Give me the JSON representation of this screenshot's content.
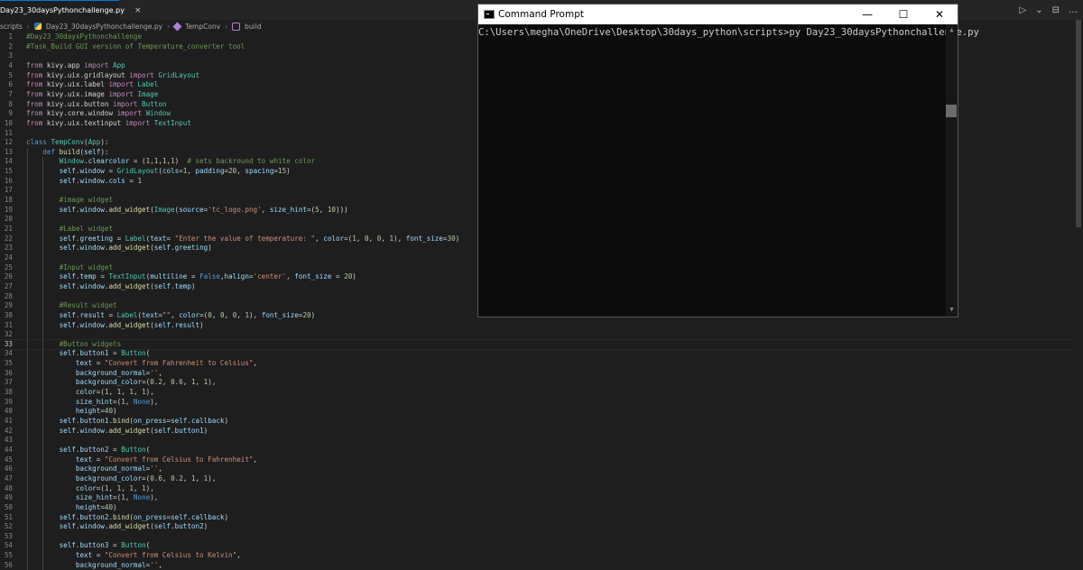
{
  "tab": {
    "title": "Day23_30daysPythonchallenge.py",
    "close": "×"
  },
  "tab_actions": {
    "run": "▷",
    "run_menu": "⌄",
    "split": "⊟",
    "more": "…"
  },
  "breadcrumb": {
    "folder": "scripts",
    "file": "Day23_30daysPythonchallenge.py",
    "class": "TempConv",
    "method": "build"
  },
  "editor": {
    "lines": [
      {
        "n": "1",
        "html": "<span class='cmt'>#Day23_30daysPythonchallenge</span>"
      },
      {
        "n": "2",
        "html": "<span class='cmt'>#Task_Build GUI version of Temperature_converter tool</span>"
      },
      {
        "n": "3",
        "html": ""
      },
      {
        "n": "4",
        "html": "<span class='kw2'>from</span> kivy.app <span class='kw2'>import</span> <span class='cls'>App</span>"
      },
      {
        "n": "5",
        "html": "<span class='kw2'>from</span> kivy.uix.gridlayout <span class='kw2'>import</span> <span class='cls'>GridLayout</span>"
      },
      {
        "n": "6",
        "html": "<span class='kw2'>from</span> kivy.uix.label <span class='kw2'>import</span> <span class='cls'>Label</span>"
      },
      {
        "n": "7",
        "html": "<span class='kw2'>from</span> kivy.uix.image <span class='kw2'>import</span> <span class='cls'>Image</span>"
      },
      {
        "n": "8",
        "html": "<span class='kw2'>from</span> kivy.uix.button <span class='kw2'>import</span> <span class='cls'>Button</span>"
      },
      {
        "n": "9",
        "html": "<span class='kw2'>from</span> kivy.core.window <span class='kw2'>import</span> <span class='cls'>Window</span>"
      },
      {
        "n": "10",
        "html": "<span class='kw2'>from</span> kivy.uix.textinput <span class='kw2'>import</span> <span class='cls'>TextInput</span>"
      },
      {
        "n": "11",
        "html": ""
      },
      {
        "n": "12",
        "html": "<span class='kw'>class</span> <span class='cls'>TempConv</span>(<span class='cls'>App</span>):"
      },
      {
        "n": "13",
        "html": "    <span class='kw'>def</span> <span class='fn'>build</span>(<span class='self'>self</span>):"
      },
      {
        "n": "14",
        "html": "        <span class='cls'>Window</span>.<span class='var'>clearcolor</span> = (<span class='num'>1</span>,<span class='num'>1</span>,<span class='num'>1</span>,<span class='num'>1</span>)  <span class='cmt'># sets backround to white color</span>"
      },
      {
        "n": "15",
        "html": "        <span class='self'>self</span>.<span class='var'>window</span> = <span class='cls'>GridLayout</span>(<span class='var'>cols</span>=<span class='num'>1</span>, <span class='var'>padding</span>=<span class='num'>20</span>, <span class='var'>spacing</span>=<span class='num'>15</span>)"
      },
      {
        "n": "16",
        "html": "        <span class='self'>self</span>.<span class='var'>window</span>.<span class='var'>cols</span> = <span class='num'>1</span>"
      },
      {
        "n": "17",
        "html": ""
      },
      {
        "n": "18",
        "html": "        <span class='cmt'>#image widget</span>"
      },
      {
        "n": "19",
        "html": "        <span class='self'>self</span>.<span class='var'>window</span>.<span class='fn'>add_widget</span>(<span class='cls'>Image</span>(<span class='var'>source</span>=<span class='str'>'tc_logo.png'</span>, <span class='var'>size_hint</span>=(<span class='num'>5</span>, <span class='num'>10</span>)))"
      },
      {
        "n": "20",
        "html": ""
      },
      {
        "n": "21",
        "html": "        <span class='cmt'>#Label widget</span>"
      },
      {
        "n": "22",
        "html": "        <span class='self'>self</span>.<span class='var'>greeting</span> = <span class='cls'>Label</span>(<span class='var'>text</span>= <span class='str'>\"Enter the value of temperature: \"</span>, <span class='var'>color</span>=(<span class='num'>1</span>, <span class='num'>0</span>, <span class='num'>0</span>, <span class='num'>1</span>), <span class='var'>font_size</span>=<span class='num'>30</span>)"
      },
      {
        "n": "23",
        "html": "        <span class='self'>self</span>.<span class='var'>window</span>.<span class='fn'>add_widget</span>(<span class='self'>self</span>.<span class='var'>greeting</span>)"
      },
      {
        "n": "24",
        "html": ""
      },
      {
        "n": "25",
        "html": "        <span class='cmt'>#Input widget</span>"
      },
      {
        "n": "26",
        "html": "        <span class='self'>self</span>.<span class='var'>temp</span> = <span class='cls'>TextInput</span>(<span class='var'>multiline</span> = <span class='kw'>False</span>,<span class='var'>halign</span>=<span class='str'>'center'</span>, <span class='var'>font_size</span> = <span class='num'>20</span>)"
      },
      {
        "n": "27",
        "html": "        <span class='self'>self</span>.<span class='var'>window</span>.<span class='fn'>add_widget</span>(<span class='self'>self</span>.<span class='var'>temp</span>)"
      },
      {
        "n": "28",
        "html": ""
      },
      {
        "n": "29",
        "html": "        <span class='cmt'>#Result widget</span>"
      },
      {
        "n": "30",
        "html": "        <span class='self'>self</span>.<span class='var'>result</span> = <span class='cls'>Label</span>(<span class='var'>text</span>=<span class='str'>\"\"</span>, <span class='var'>color</span>=(<span class='num'>0</span>, <span class='num'>0</span>, <span class='num'>0</span>, <span class='num'>1</span>), <span class='var'>font_size</span>=<span class='num'>20</span>)"
      },
      {
        "n": "31",
        "html": "        <span class='self'>self</span>.<span class='var'>window</span>.<span class='fn'>add_widget</span>(<span class='self'>self</span>.<span class='var'>result</span>)"
      },
      {
        "n": "32",
        "html": ""
      },
      {
        "n": "33",
        "html": "        <span class='cmt'>#Button widgets</span>"
      },
      {
        "n": "34",
        "html": "        <span class='self'>self</span>.<span class='var'>button1</span> = <span class='cls'>Button</span>("
      },
      {
        "n": "35",
        "html": "            <span class='var'>text</span> = <span class='str'>\"Convert from Fahrenheit to Celsius\"</span>,"
      },
      {
        "n": "36",
        "html": "            <span class='var'>background_normal</span>=<span class='str'>''</span>,"
      },
      {
        "n": "37",
        "html": "            <span class='var'>background_color</span>=(<span class='num'>0.2</span>, <span class='num'>0.6</span>, <span class='num'>1</span>, <span class='num'>1</span>),"
      },
      {
        "n": "38",
        "html": "            <span class='var'>color</span>=(<span class='num'>1</span>, <span class='num'>1</span>, <span class='num'>1</span>, <span class='num'>1</span>),"
      },
      {
        "n": "39",
        "html": "            <span class='var'>size_hint</span>=(<span class='num'>1</span>, <span class='kw'>None</span>),"
      },
      {
        "n": "40",
        "html": "            <span class='var'>height</span>=<span class='num'>40</span>)"
      },
      {
        "n": "41",
        "html": "        <span class='self'>self</span>.<span class='var'>button1</span>.<span class='fn'>bind</span>(<span class='var'>on_press</span>=<span class='self'>self</span>.<span class='var'>callback</span>)"
      },
      {
        "n": "42",
        "html": "        <span class='self'>self</span>.<span class='var'>window</span>.<span class='fn'>add_widget</span>(<span class='self'>self</span>.<span class='var'>button1</span>)"
      },
      {
        "n": "43",
        "html": ""
      },
      {
        "n": "44",
        "html": "        <span class='self'>self</span>.<span class='var'>button2</span> = <span class='cls'>Button</span>("
      },
      {
        "n": "45",
        "html": "            <span class='var'>text</span> = <span class='str'>\"Convert from Celsius to Fahrenheit\"</span>,"
      },
      {
        "n": "46",
        "html": "            <span class='var'>background_normal</span>=<span class='str'>''</span>,"
      },
      {
        "n": "47",
        "html": "            <span class='var'>background_color</span>=(<span class='num'>0.6</span>, <span class='num'>0.2</span>, <span class='num'>1</span>, <span class='num'>1</span>),"
      },
      {
        "n": "48",
        "html": "            <span class='var'>color</span>=(<span class='num'>1</span>, <span class='num'>1</span>, <span class='num'>1</span>, <span class='num'>1</span>),"
      },
      {
        "n": "49",
        "html": "            <span class='var'>size_hint</span>=(<span class='num'>1</span>, <span class='kw'>None</span>),"
      },
      {
        "n": "50",
        "html": "            <span class='var'>height</span>=<span class='num'>40</span>)"
      },
      {
        "n": "51",
        "html": "        <span class='self'>self</span>.<span class='var'>button2</span>.<span class='fn'>bind</span>(<span class='var'>on_press</span>=<span class='self'>self</span>.<span class='var'>callback</span>)"
      },
      {
        "n": "52",
        "html": "        <span class='self'>self</span>.<span class='var'>window</span>.<span class='fn'>add_widget</span>(<span class='self'>self</span>.<span class='var'>button2</span>)"
      },
      {
        "n": "53",
        "html": ""
      },
      {
        "n": "54",
        "html": "        <span class='self'>self</span>.<span class='var'>button3</span> = <span class='cls'>Button</span>("
      },
      {
        "n": "55",
        "html": "            <span class='var'>text</span> = <span class='str'>\"Convert from Celsius to Kelvin\"</span>,"
      },
      {
        "n": "56",
        "html": "            <span class='var'>background_normal</span>=<span class='str'>''</span>,"
      }
    ],
    "active_line": "33"
  },
  "cmd": {
    "title": "Command Prompt",
    "minimize": "—",
    "maximize": "☐",
    "close": "✕",
    "prompt_line": "C:\\Users\\megha\\OneDrive\\Desktop\\30days_python\\scripts>py Day23_30daysPythonchallenge.py",
    "scroll_up": "▲",
    "scroll_down": "▼"
  }
}
